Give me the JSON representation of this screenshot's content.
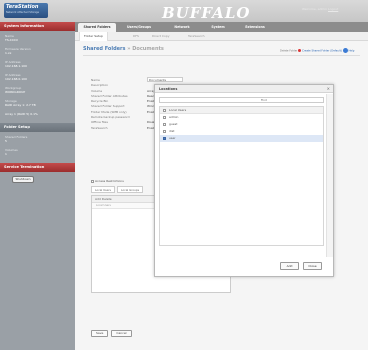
{
  "header": {
    "logo_name": "TeraStation",
    "logo_sub": "Network Attached Storage",
    "brand": "BUFFALO",
    "welcome_text": "Welcome, admin",
    "welcome_link": "Logout"
  },
  "sidebar": {
    "info_title": "System Information",
    "info_items": [
      {
        "label": "Name",
        "value": "TS-XXXX"
      },
      {
        "label": "Firmware Version",
        "value": "1.xx"
      },
      {
        "label": "IP Address",
        "value": "192.168.1.100"
      },
      {
        "label": "IP Address",
        "value": "192.168.0.100"
      },
      {
        "label": "Workgroup",
        "value": "WORKGROUP"
      },
      {
        "label": "Storage",
        "value": "RAID Array 1: 2.7 TB"
      },
      {
        "label": "",
        "value": "Array 1 (RAID 5) 0.1%"
      }
    ],
    "folder_title": "Folder Setup",
    "folder_items": [
      {
        "label": "Shared Folders",
        "value": "5"
      },
      {
        "label": "Volumes",
        "value": "1"
      }
    ],
    "shutdown_title": "Service Termination",
    "shutdown_button": "Shutdown"
  },
  "tabs": [
    {
      "label": "Shared Folders",
      "active": true
    },
    {
      "label": "Users/Groups",
      "active": false
    },
    {
      "label": "Network",
      "active": false
    },
    {
      "label": "System",
      "active": false
    },
    {
      "label": "Extensions",
      "active": false
    }
  ],
  "subtabs": [
    {
      "label": "Folder Setup",
      "active": true
    },
    {
      "label": "DFS",
      "active": false
    },
    {
      "label": "Direct Copy",
      "active": false
    },
    {
      "label": "TeraSearch",
      "active": false
    }
  ],
  "content": {
    "breadcrumb_root": "Shared Folders",
    "breadcrumb_sep": "»",
    "breadcrumb_leaf": "Documents",
    "top_actions_text": "Delete Folder",
    "top_actions_link": "Create Shared Folder (Default)",
    "help_label": "Help",
    "form": {
      "rows": [
        {
          "label": "Name",
          "value": "Documents"
        },
        {
          "label": "Description",
          "value": ""
        },
        {
          "label": "Volume",
          "value": "Array 1"
        },
        {
          "label": "Shared Folder Attributes",
          "value": "Read & Write"
        },
        {
          "label": "Recycle Bin",
          "value": "Enable"
        },
        {
          "label": "Shared Folder Support",
          "value": "Windows"
        },
        {
          "label": "Folder Mode (SMB only)",
          "value": "Enable"
        },
        {
          "label": "Remote backup password",
          "value": ""
        },
        {
          "label": "Offline files",
          "value": "Disable"
        },
        {
          "label": "TeraSearch",
          "value": "Enable"
        }
      ]
    },
    "access": {
      "header": "Access Restrictions",
      "tabs": [
        "Local Users",
        "Local Groups"
      ],
      "toolbar_add": "Add",
      "toolbar_delete": "Delete",
      "list_header": "Local Users"
    },
    "buttons": {
      "ok": "Save",
      "cancel": "Cancel"
    }
  },
  "dialog": {
    "title": "Locations",
    "close": "×",
    "search_label": "Find",
    "list_header": "Local Users",
    "items": [
      {
        "name": "admin",
        "checked": false,
        "selected": false
      },
      {
        "name": "guest",
        "checked": false,
        "selected": false
      },
      {
        "name": "dist",
        "checked": false,
        "selected": false
      },
      {
        "name": "user",
        "checked": true,
        "selected": true
      }
    ],
    "add_button": "Add",
    "close_button": "Close"
  }
}
